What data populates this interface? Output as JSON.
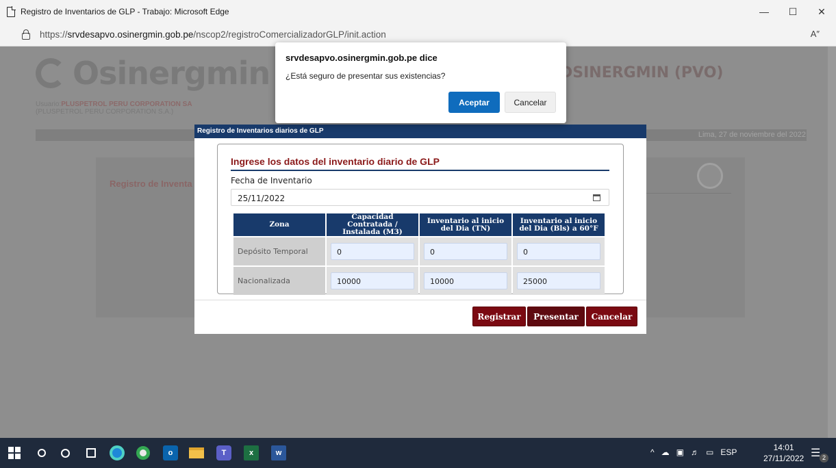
{
  "browser": {
    "window_title": "Registro de Inventarios de GLP - Trabajo: Microsoft Edge",
    "url_prefix": "https://",
    "url_host": "srvdesapvo.osinergmin.gob.pe",
    "url_path": "/nscop2/registroComercializadorGLP/init.action",
    "read_aloud_label": "A″",
    "minimize_label": "—",
    "maximize_label": "☐",
    "close_label": "✕"
  },
  "page": {
    "logo_text": "Osinergmin",
    "title_right": "DSINERGMIN (PVO)",
    "user_prefix": "Usuario:",
    "user_name": "PLUSPETROL PERU CORPORATION SA",
    "user_company": "(PLUSPETROL PERU CORPORATION S.A.)",
    "date_text": "Lima, 27 de noviembre del 2022",
    "panel_title": "Registro de Inventa"
  },
  "modal": {
    "header": "Registro de Inventarios diarios de GLP",
    "section_title": "Ingrese los datos del inventario diario de GLP",
    "date_label": "Fecha de Inventario",
    "date_value": "25/11/2022",
    "table": {
      "headers": [
        "Zona",
        "Capacidad Contratada / Instalada (M3)",
        "Inventario al inicio del Dia (TN)",
        "Inventario al inicio del Dia (Bls) a 60°F"
      ],
      "rows": [
        {
          "zona": "Depósito Temporal",
          "capacidad": "0",
          "inv_tn": "0",
          "inv_bls": "0"
        },
        {
          "zona": "Nacionalizada",
          "capacidad": "10000",
          "inv_tn": "10000",
          "inv_bls": "25000"
        }
      ]
    },
    "buttons": {
      "registrar": "Registrar",
      "presentar": "Presentar",
      "cancelar": "Cancelar"
    }
  },
  "alert": {
    "title": "srvdesapvo.osinergmin.gob.pe dice",
    "message": "¿Está seguro de presentar sus existencias?",
    "ok_label": "Aceptar",
    "cancel_label": "Cancelar"
  },
  "taskbar": {
    "tray_lang": "ESP",
    "time": "14:01",
    "date": "27/11/2022",
    "notification_count": "2",
    "excel_label": "x",
    "word_label": "w",
    "teams_label": "T",
    "outlook_label": "o"
  }
}
